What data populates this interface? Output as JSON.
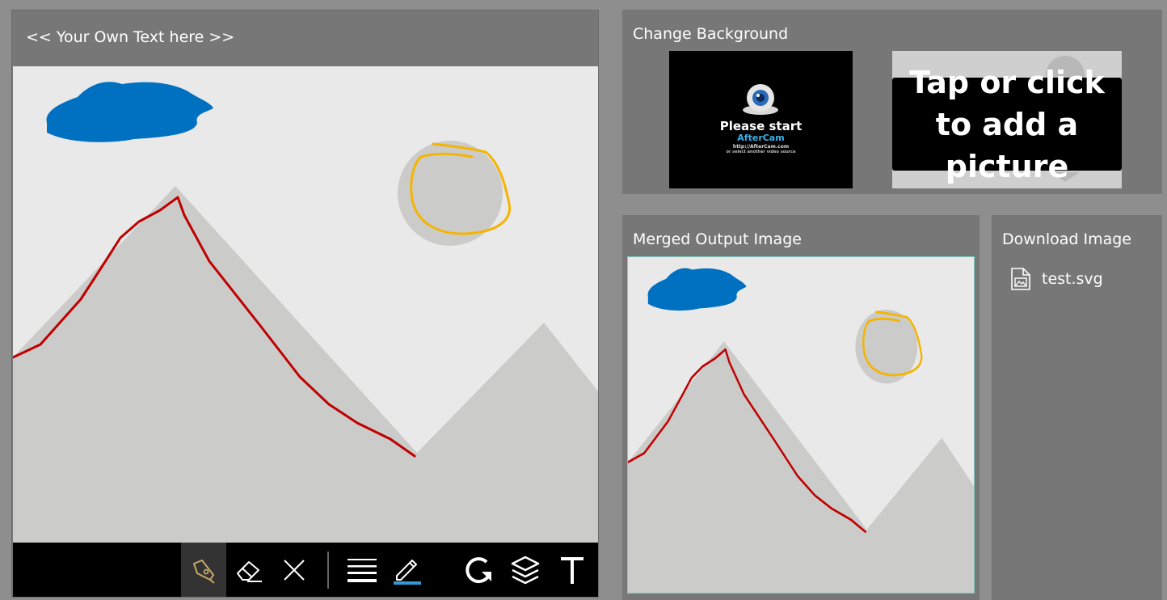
{
  "ink_panel": {
    "header_text": "<< Your Own Text here >>",
    "toolbar": [
      {
        "name": "ballpoint-pen-tool",
        "icon": "pen-nib-icon",
        "active": true
      },
      {
        "name": "eraser-tool",
        "icon": "eraser-icon",
        "active": false
      },
      {
        "name": "clear-all-tool",
        "icon": "close-icon",
        "active": false
      },
      {
        "name": "stroke-thickness-tool",
        "icon": "lines-icon",
        "active": false
      },
      {
        "name": "pencil-tool",
        "icon": "pencil-icon",
        "active": false
      },
      {
        "name": "rotate-tool",
        "icon": "rotate-icon",
        "active": false
      },
      {
        "name": "layers-tool",
        "icon": "layers-icon",
        "active": false
      },
      {
        "name": "text-tool",
        "icon": "text-icon",
        "active": false
      }
    ],
    "ink_colors": {
      "blue": "#0070c0",
      "red": "#c00000",
      "yellow": "#f5b400"
    }
  },
  "change_background": {
    "title": "Change Background",
    "webcam_thumb": {
      "line1": "Please start",
      "line2": "AfterCam",
      "line3": "http://AfterCam.com",
      "line4": "or select another video source"
    },
    "upload_text": "Tap or click to add a picture"
  },
  "merged_output": {
    "title": "Merged Output Image"
  },
  "download": {
    "title": "Download Image",
    "file_name": "test.svg",
    "icon": "image-file-icon"
  },
  "colors": {
    "page_bg": "#8e8e8e",
    "panel_bg": "#777777",
    "canvas_bg": "#e9e9e9",
    "mountain": "#cbcbca",
    "toolbar_bg": "#000000",
    "accent_underline": "#2e9bd6",
    "pen_icon": "#c8a86a"
  }
}
